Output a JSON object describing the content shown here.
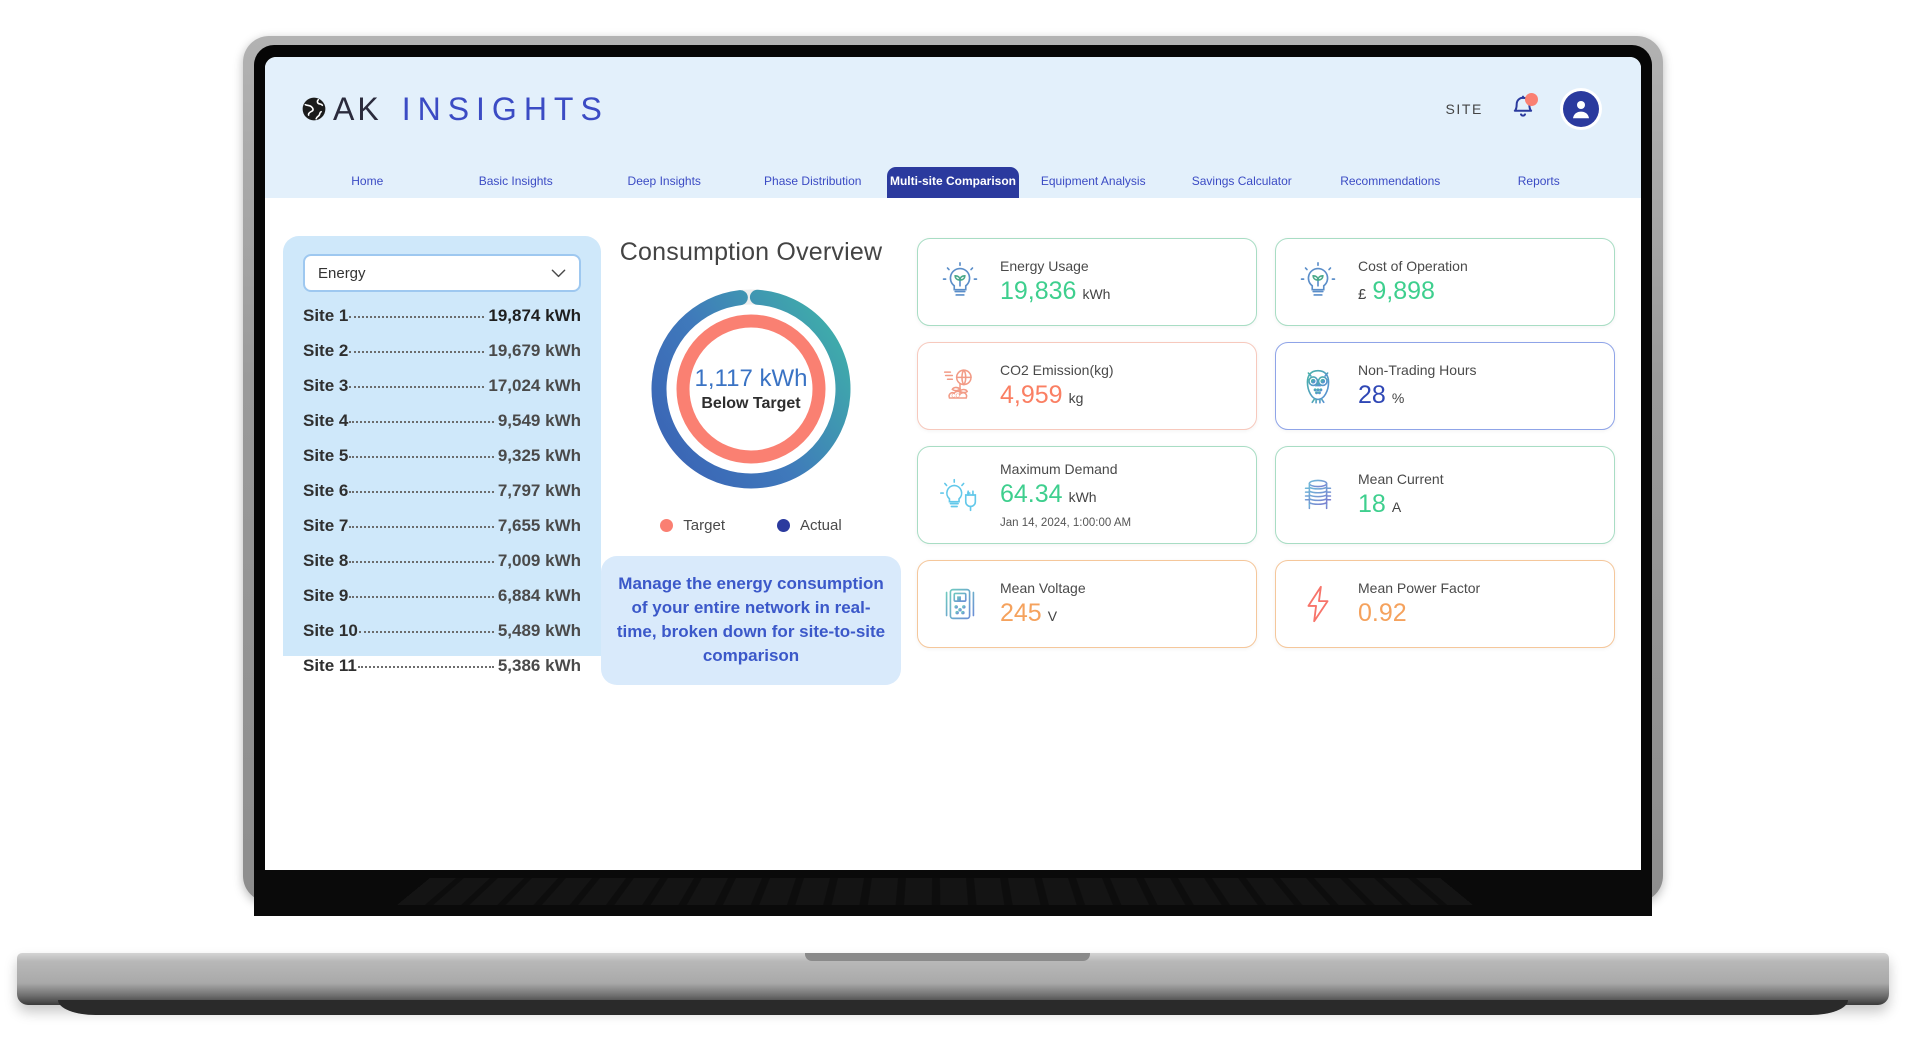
{
  "header": {
    "brand_ak": "AK",
    "brand_insights": "INSIGHTS",
    "globe_icon": "globe-icon",
    "site_label": "SITE",
    "bell_icon": "bell-icon",
    "avatar_icon": "avatar-icon"
  },
  "nav": {
    "items": [
      {
        "label": "Home",
        "active": false
      },
      {
        "label": "Basic Insights",
        "active": false
      },
      {
        "label": "Deep Insights",
        "active": false
      },
      {
        "label": "Phase Distribution",
        "active": false
      },
      {
        "label": "Multi-site Comparison",
        "active": true
      },
      {
        "label": "Equipment Analysis",
        "active": false
      },
      {
        "label": "Savings Calculator",
        "active": false
      },
      {
        "label": "Recommendations",
        "active": false
      },
      {
        "label": "Reports",
        "active": false
      }
    ]
  },
  "sidebar": {
    "metric_select": {
      "value": "Energy",
      "options": [
        "Energy"
      ]
    },
    "sites": [
      {
        "name": "Site 1",
        "value": "19,874",
        "unit": "kWh"
      },
      {
        "name": "Site 2",
        "value": "19,679",
        "unit": "kWh"
      },
      {
        "name": "Site 3",
        "value": "17,024",
        "unit": "kWh"
      },
      {
        "name": "Site 4",
        "value": "9,549",
        "unit": "kWh"
      },
      {
        "name": "Site 5",
        "value": "9,325",
        "unit": "kWh"
      },
      {
        "name": "Site 6",
        "value": "7,797",
        "unit": "kWh"
      },
      {
        "name": "Site 7",
        "value": "7,655",
        "unit": "kWh"
      },
      {
        "name": "Site 8",
        "value": "7,009",
        "unit": "kWh"
      },
      {
        "name": "Site 9",
        "value": "6,884",
        "unit": "kWh"
      },
      {
        "name": "Site 10",
        "value": "5,489",
        "unit": "kWh"
      },
      {
        "name": "Site 11",
        "value": "5,386",
        "unit": "kWh"
      }
    ]
  },
  "overview": {
    "title": "Consumption Overview",
    "center_value": "1,117 kWh",
    "center_sub": "Below Target",
    "legend": [
      {
        "label": "Target",
        "color": "#fa7f72"
      },
      {
        "label": "Actual",
        "color": "#2b3a9e"
      }
    ],
    "info_text": "Manage the energy consumption of your entire network in real-time, broken down for site-to-site comparison"
  },
  "chart_data": {
    "type": "pie",
    "title": "Consumption Overview",
    "subtitle": "1,117 kWh Below Target",
    "legend_position": "bottom",
    "rings": [
      {
        "name": "Actual",
        "ring": "outer",
        "fraction_filled": 0.97,
        "gap_degrees": 10,
        "start_angle_deg": 5,
        "color_start": "#3a63b5",
        "color_end": "#3fb0a9"
      },
      {
        "name": "Target",
        "ring": "inner",
        "fraction_filled": 1.0,
        "gap_degrees": 0,
        "start_angle_deg": 0,
        "color_start": "#fa8072",
        "color_end": "#fa8072"
      }
    ],
    "track_color": "#eeeeee",
    "center_label": "1,117 kWh",
    "center_sublabel": "Below Target"
  },
  "cards": [
    {
      "id": "energy-usage",
      "label": "Energy Usage",
      "prefix": "",
      "value": "19,836",
      "unit": "kWh",
      "timestamp": "",
      "accent": "#3ecf8e",
      "border": "#a8ddc4",
      "theme": "green",
      "icon": "lightbulb-leaf-icon"
    },
    {
      "id": "cost-of-operation",
      "label": "Cost of Operation",
      "prefix": "£",
      "value": "9,898",
      "unit": "",
      "timestamp": "",
      "accent": "#3ecf8e",
      "border": "#a8ddc4",
      "theme": "green",
      "icon": "lightbulb-leaf-icon"
    },
    {
      "id": "co2-emission",
      "label": "CO2 Emission(kg)",
      "prefix": "",
      "value": "4,959",
      "unit": "kg",
      "timestamp": "",
      "accent": "#fa7f63",
      "border": "#f7c9bd",
      "theme": "coral",
      "icon": "co2-plant-icon"
    },
    {
      "id": "non-trading-hours",
      "label": "Non-Trading Hours",
      "prefix": "",
      "value": "28",
      "unit": "%",
      "timestamp": "",
      "accent": "#2f47b5",
      "border": "#8fa4e8",
      "theme": "blue",
      "icon": "owl-icon"
    },
    {
      "id": "maximum-demand",
      "label": "Maximum Demand",
      "prefix": "",
      "value": "64.34",
      "unit": "kWh",
      "timestamp": "Jan 14, 2024, 1:00:00 AM",
      "accent": "#3ecf8e",
      "border": "#a8ddc4",
      "theme": "green",
      "icon": "bulb-plug-icon"
    },
    {
      "id": "mean-current",
      "label": "Mean Current",
      "prefix": "",
      "value": "18",
      "unit": "A",
      "timestamp": "",
      "accent": "#3ecf8e",
      "border": "#a8ddc4",
      "theme": "green",
      "icon": "coil-icon"
    },
    {
      "id": "mean-voltage",
      "label": "Mean Voltage",
      "prefix": "",
      "value": "245",
      "unit": "V",
      "timestamp": "",
      "accent": "#f5a25d",
      "border": "#f5c79b",
      "theme": "orange",
      "icon": "multimeter-icon"
    },
    {
      "id": "mean-power-factor",
      "label": "Mean Power Factor",
      "prefix": "",
      "value": "0.92",
      "unit": "",
      "timestamp": "",
      "accent": "#f5a25d",
      "border": "#f5c79b",
      "theme": "orange",
      "icon": "lightning-bolt-icon"
    }
  ]
}
